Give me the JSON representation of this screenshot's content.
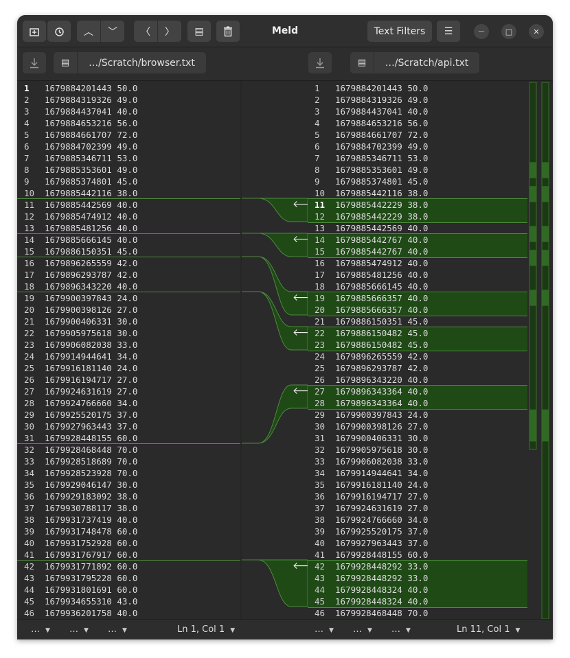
{
  "window": {
    "title": "Meld",
    "text_filters_label": "Text Filters",
    "minimize_glyph": "—",
    "maximize_glyph": "□",
    "close_glyph": "✕"
  },
  "toolbar": {
    "new_tab_icon": "new-tab-icon",
    "history_icon": "history-icon",
    "prev_change_glyph": "︿",
    "next_change_glyph": "﹀",
    "prev_conflict_glyph": "〈",
    "next_conflict_glyph": "〉",
    "copy_glyph": "▤",
    "delete_glyph": "🗑",
    "menu_glyph": "☰"
  },
  "files": {
    "left_path": "…/Scratch/browser.txt",
    "right_path": "…/Scratch/api.txt"
  },
  "left_lines": [
    "1679884201443 50.0",
    "1679884319326 49.0",
    "1679884437041 40.0",
    "1679884653216 56.0",
    "1679884661707 72.0",
    "1679884702399 49.0",
    "1679885346711 53.0",
    "1679885353601 49.0",
    "1679885374801 45.0",
    "1679885442116 38.0",
    "1679885442569 40.0",
    "1679885474912 40.0",
    "1679885481256 40.0",
    "1679885666145 40.0",
    "1679886150351 45.0",
    "1679896265559 42.0",
    "1679896293787 42.0",
    "1679896343220 40.0",
    "1679900397843 24.0",
    "1679900398126 27.0",
    "1679900406331 30.0",
    "1679905975618 30.0",
    "1679906082038 33.0",
    "1679914944641 34.0",
    "1679916181140 24.0",
    "1679916194717 27.0",
    "1679924631619 27.0",
    "1679924766660 34.0",
    "1679925520175 37.0",
    "1679927963443 37.0",
    "1679928448155 60.0",
    "1679928468448 70.0",
    "1679928518689 70.0",
    "1679928523928 70.0",
    "1679929046147 30.0",
    "1679929183092 38.0",
    "1679930788117 38.0",
    "1679931737419 40.0",
    "1679931748478 60.0",
    "1679931752928 60.0",
    "1679931767917 60.0",
    "1679931771892 60.0",
    "1679931795228 60.0",
    "1679931801691 60.0",
    "1679934655310 43.0",
    "1679936201758 40.0"
  ],
  "right_lines": [
    "1679884201443 50.0",
    "1679884319326 49.0",
    "1679884437041 40.0",
    "1679884653216 56.0",
    "1679884661707 72.0",
    "1679884702399 49.0",
    "1679885346711 53.0",
    "1679885353601 49.0",
    "1679885374801 45.0",
    "1679885442116 38.0",
    "1679885442229 38.0",
    "1679885442229 38.0",
    "1679885442569 40.0",
    "1679885442767 40.0",
    "1679885442767 40.0",
    "1679885474912 40.0",
    "1679885481256 40.0",
    "1679885666145 40.0",
    "1679885666357 40.0",
    "1679885666357 40.0",
    "1679886150351 45.0",
    "1679886150482 45.0",
    "1679886150482 45.0",
    "1679896265559 42.0",
    "1679896293787 42.0",
    "1679896343220 40.0",
    "1679896343364 40.0",
    "1679896343364 40.0",
    "1679900397843 24.0",
    "1679900398126 27.0",
    "1679900406331 30.0",
    "1679905975618 30.0",
    "1679906082038 33.0",
    "1679914944641 34.0",
    "1679916181140 24.0",
    "1679916194717 27.0",
    "1679924631619 27.0",
    "1679924766660 34.0",
    "1679925520175 37.0",
    "1679927963443 37.0",
    "1679928448155 60.0",
    "1679928448292 33.0",
    "1679928448292 33.0",
    "1679928448324 40.0",
    "1679928448324 40.0",
    "1679928468448 70.0"
  ],
  "left_current_line": 1,
  "right_current_line": 11,
  "chunks": [
    {
      "left_after": 10,
      "right_start": 11,
      "right_end": 12
    },
    {
      "left_after": 13,
      "right_start": 14,
      "right_end": 15
    },
    {
      "left_after": 15,
      "right_start": 19,
      "right_end": 20
    },
    {
      "left_after": 18,
      "right_start": 22,
      "right_end": 23
    },
    {
      "left_after": 31,
      "right_start": 27,
      "right_end": 28
    },
    {
      "left_after": 41,
      "right_start": 42,
      "right_end": 45
    }
  ],
  "status": {
    "left_items": [
      "…",
      "…",
      "…"
    ],
    "left_position": "Ln 1, Col 1",
    "right_items": [
      "…",
      "…",
      "…"
    ],
    "right_position": "Ln 11, Col 1"
  },
  "colors": {
    "insert_bg": "#1f4a16",
    "insert_border": "#4d8a3d",
    "overview_fill": "#2f6a22"
  }
}
